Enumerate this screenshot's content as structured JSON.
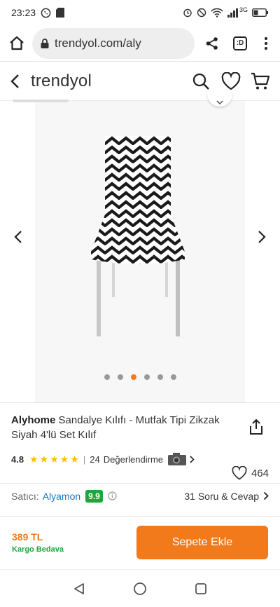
{
  "status": {
    "time": "23:23",
    "network": "3G"
  },
  "browser": {
    "url": "trendyol.com/aly",
    "tab_label": ":D"
  },
  "app": {
    "logo": "trendyol"
  },
  "gallery": {
    "image_count": 6,
    "active_index": 3
  },
  "product": {
    "brand": "Alyhome",
    "name": "Sandalye Kılıfı - Mutfak Tipi Zikzak Siyah 4'lü Set Kılıf",
    "rating": "4.8",
    "stars": 5,
    "reviews": "24",
    "reviews_label": "Değerlendirme",
    "favorites": "464"
  },
  "seller": {
    "label": "Satıcı:",
    "name": "Alyamon",
    "score": "9.9",
    "qa": "31 Soru & Cevap"
  },
  "buy": {
    "price": "389 TL",
    "shipping": "Kargo Bedava",
    "add_to_cart": "Sepete Ekle"
  },
  "colors": {
    "accent": "#f27a1a",
    "green": "#1ea53b",
    "seller_blue": "#1a73c6"
  }
}
